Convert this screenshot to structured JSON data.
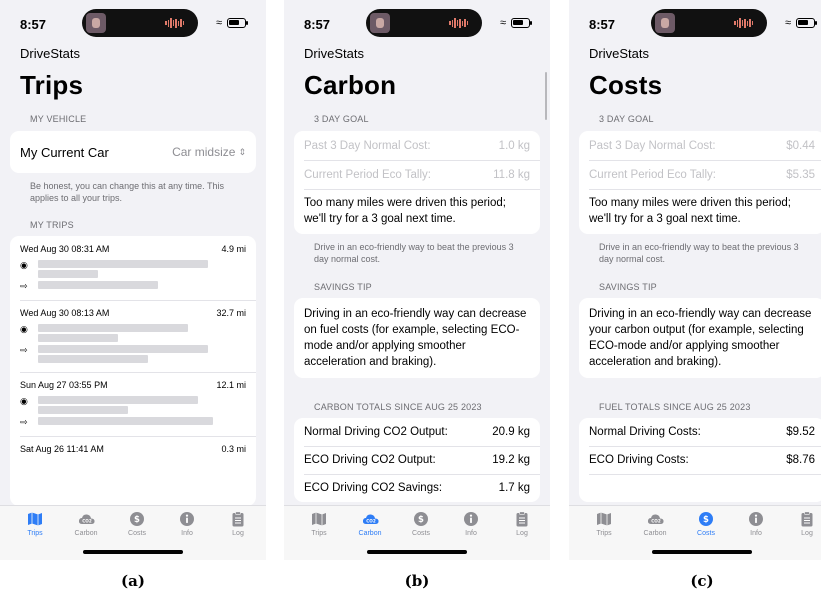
{
  "status": {
    "time": "8:57"
  },
  "app_name": "DriveStats",
  "tabs": [
    {
      "label": "Trips",
      "icon": "map-icon"
    },
    {
      "label": "Carbon",
      "icon": "cloud-co2-icon"
    },
    {
      "label": "Costs",
      "icon": "dollar-coin-icon"
    },
    {
      "label": "Info",
      "icon": "info-icon"
    },
    {
      "label": "Log",
      "icon": "clipboard-icon"
    }
  ],
  "colors": {
    "accent": "#2e7df6",
    "inactive_tab": "#8e8e93",
    "background": "#f2f2f6"
  },
  "screens": {
    "trips": {
      "title": "Trips",
      "caption": "(a)",
      "my_vehicle_header": "MY VEHICLE",
      "vehicle_label": "My Current Car",
      "vehicle_value": "Car midsize",
      "vehicle_footer": "Be honest, you can change this at any time. This applies to all your trips.",
      "my_trips_header": "MY TRIPS",
      "trips": [
        {
          "date": "Wed Aug 30 08:31 AM",
          "distance": "4.9 mi"
        },
        {
          "date": "Wed Aug 30 08:13 AM",
          "distance": "32.7 mi"
        },
        {
          "date": "Sun Aug 27 03:55 PM",
          "distance": "12.1 mi"
        },
        {
          "date": "Sat Aug 26 11:41 AM",
          "distance": "0.3 mi"
        }
      ]
    },
    "carbon": {
      "title": "Carbon",
      "caption": "(b)",
      "goal_header": "3 DAY GOAL",
      "goal_rows": [
        {
          "label": "Past 3 Day Normal Cost:",
          "value": "1.0 kg"
        },
        {
          "label": "Current Period Eco Tally:",
          "value": "11.8 kg"
        }
      ],
      "goal_message": "Too many miles were driven this period; we'll try for a 3 goal next time.",
      "goal_footer": "Drive in an eco-friendly way to beat the previous 3 day normal cost.",
      "tip_header": "SAVINGS TIP",
      "tip_text": "Driving in an eco-friendly way can decrease on fuel costs (for example, selecting ECO-mode and/or applying smoother acceleration and braking).",
      "totals_header": "CARBON TOTALS SINCE AUG 25 2023",
      "totals": [
        {
          "label": "Normal Driving CO2 Output:",
          "value": "20.9 kg"
        },
        {
          "label": "ECO Driving CO2 Output:",
          "value": "19.2 kg"
        },
        {
          "label": "ECO Driving CO2 Savings:",
          "value": "1.7 kg"
        }
      ]
    },
    "costs": {
      "title": "Costs",
      "caption": "(c)",
      "goal_header": "3 DAY GOAL",
      "goal_rows": [
        {
          "label": "Past 3 Day Normal Cost:",
          "value": "$0.44"
        },
        {
          "label": "Current Period Eco Tally:",
          "value": "$5.35"
        }
      ],
      "goal_message": "Too many miles were driven this period; we'll try for a 3 goal next time.",
      "goal_footer": "Drive in an eco-friendly way to beat the previous 3 day normal cost.",
      "tip_header": "SAVINGS TIP",
      "tip_text": "Driving in an eco-friendly way can decrease your carbon output (for example, selecting ECO-mode and/or applying smoother acceleration and braking).",
      "totals_header": "FUEL TOTALS SINCE AUG 25 2023",
      "totals": [
        {
          "label": "Normal Driving Costs:",
          "value": "$9.52"
        },
        {
          "label": "ECO Driving Costs:",
          "value": "$8.76"
        }
      ]
    }
  }
}
